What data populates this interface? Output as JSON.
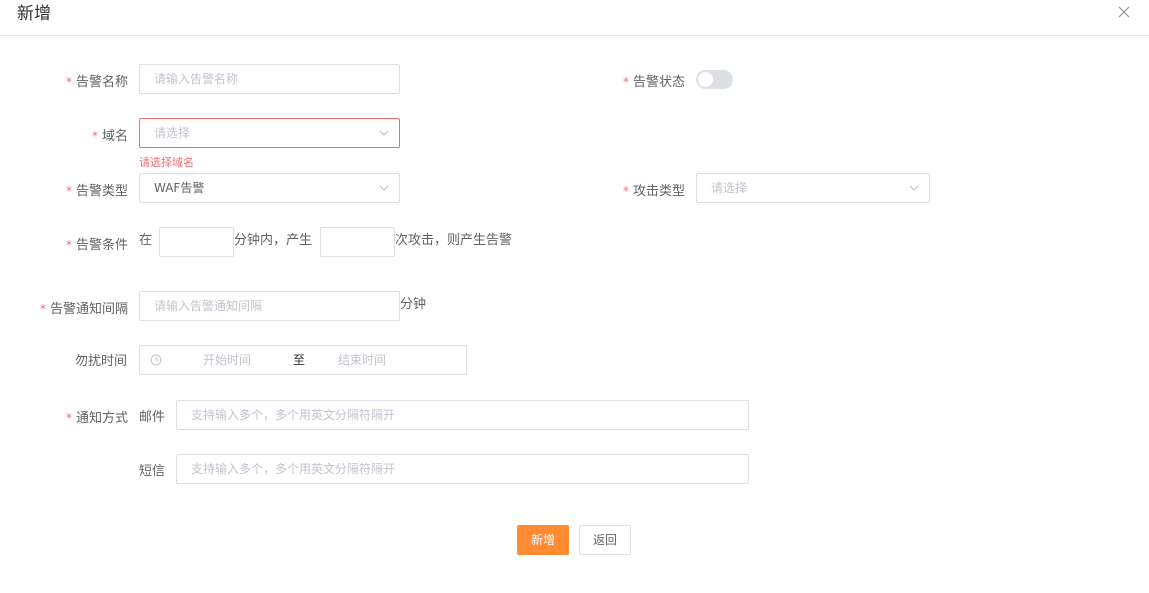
{
  "dialog": {
    "title": "新增"
  },
  "form": {
    "alarm_name": {
      "label": "告警名称",
      "placeholder": "请输入告警名称"
    },
    "alarm_status": {
      "label": "告警状态",
      "enabled": false
    },
    "domain": {
      "label": "域名",
      "placeholder": "请选择",
      "error": "请选择域名"
    },
    "alarm_type": {
      "label": "告警类型",
      "value": "WAF告警"
    },
    "attack_type": {
      "label": "攻击类型",
      "placeholder": "请选择"
    },
    "alarm_condition": {
      "label": "告警条件",
      "prefix": "在",
      "middle": "分钟内，产生",
      "suffix": "次攻击，则产生告警"
    },
    "notify_interval": {
      "label": "告警通知间隔",
      "placeholder": "请输入告警通知间隔",
      "unit": "分钟"
    },
    "dnd_time": {
      "label": "勿扰时间",
      "start": "开始时间",
      "separator": "至",
      "end": "结束时间"
    },
    "notify_method": {
      "label": "通知方式",
      "email_label": "邮件",
      "email_placeholder": "支持输入多个，多个用英文分隔符隔开",
      "sms_label": "短信",
      "sms_placeholder": "支持输入多个，多个用英文分隔符隔开"
    },
    "required_mark": "*"
  },
  "actions": {
    "submit": "新增",
    "back": "返回"
  },
  "colors": {
    "primary": "#ff8c32",
    "error": "#f56c6c",
    "border": "#dcdfe6"
  }
}
